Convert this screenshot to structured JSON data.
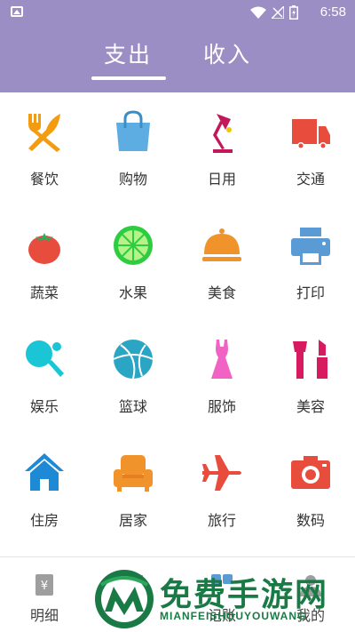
{
  "status_bar": {
    "time": "6:58",
    "icons": [
      "image-icon",
      "wifi-icon",
      "signal-icon",
      "battery-icon"
    ]
  },
  "tabs": [
    {
      "label": "支出",
      "selected": true
    },
    {
      "label": "收入",
      "selected": false
    }
  ],
  "categories": [
    {
      "label": "餐饮",
      "icon": "fork-knife-icon",
      "color": "#f39c12"
    },
    {
      "label": "购物",
      "icon": "shopping-bag-icon",
      "color": "#5dade2"
    },
    {
      "label": "日用",
      "icon": "desk-lamp-icon",
      "color": "#c2185b"
    },
    {
      "label": "交通",
      "icon": "truck-icon",
      "color": "#e74c3c"
    },
    {
      "label": "蔬菜",
      "icon": "tomato-icon",
      "color": "#e74c3c"
    },
    {
      "label": "水果",
      "icon": "lime-icon",
      "color": "#2ecc40"
    },
    {
      "label": "美食",
      "icon": "food-cloche-icon",
      "color": "#f0932b"
    },
    {
      "label": "打印",
      "icon": "printer-icon",
      "color": "#5b9bd5"
    },
    {
      "label": "娱乐",
      "icon": "ping-pong-icon",
      "color": "#1ac6d6"
    },
    {
      "label": "篮球",
      "icon": "basketball-icon",
      "color": "#2aa6c4"
    },
    {
      "label": "服饰",
      "icon": "dress-icon",
      "color": "#f062c4"
    },
    {
      "label": "美容",
      "icon": "makeup-icon",
      "color": "#d81b60"
    },
    {
      "label": "住房",
      "icon": "house-icon",
      "color": "#1e8ad6"
    },
    {
      "label": "居家",
      "icon": "sofa-icon",
      "color": "#f0932b"
    },
    {
      "label": "旅行",
      "icon": "airplane-icon",
      "color": "#e74c3c"
    },
    {
      "label": "数码",
      "icon": "camera-icon",
      "color": "#e74c3c"
    }
  ],
  "bottom_nav": [
    {
      "label": "明细",
      "icon": "ledger-icon"
    },
    {
      "label": "",
      "icon": "chart-icon"
    },
    {
      "label": "记账",
      "icon": "add-record-icon"
    },
    {
      "label": "我的",
      "icon": "user-icon"
    }
  ],
  "watermark": {
    "title": "免费手游网",
    "subtitle": "MIANFEISHOUYOUWANG"
  },
  "colors": {
    "header_bg": "#9a8ec4",
    "text": "#333333"
  }
}
